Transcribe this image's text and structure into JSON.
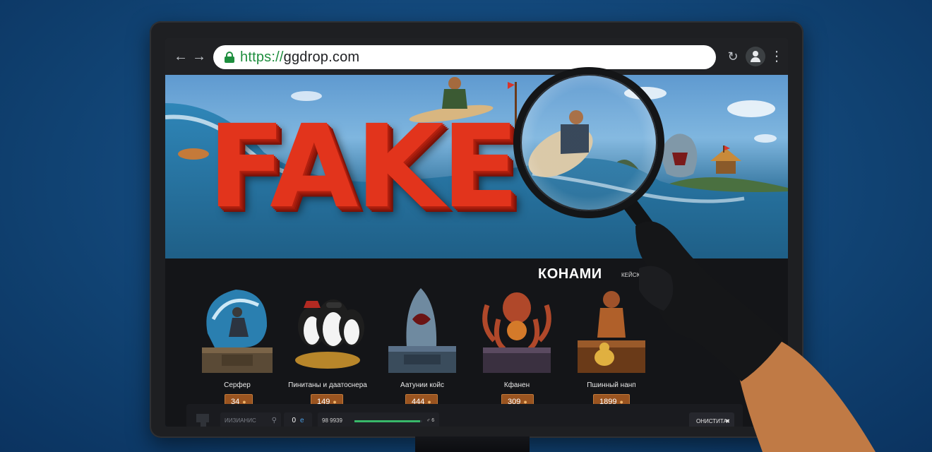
{
  "browser": {
    "url_protocol": "https://",
    "url_host": "ggdrop.com"
  },
  "hero": {
    "stamp": "FAKE"
  },
  "section": {
    "title": "КОНАМИ",
    "subtitle": "КЕЙСЮ"
  },
  "cases": [
    {
      "name": "Серфер",
      "price": "34"
    },
    {
      "name": "Пинитаны и даатоснера",
      "price": "149"
    },
    {
      "name": "Аатунии койс",
      "price": "444"
    },
    {
      "name": "Кфанен",
      "price": "309"
    },
    {
      "name": "Пшинный нанп",
      "price": "1899"
    }
  ],
  "bottom_bar": {
    "search_placeholder": "ИИЗИАНИС",
    "balance": "0",
    "balance_currency": "e",
    "progress_label": "98 9939",
    "progress_fraction": 0.97,
    "progress_suffix": "♂ 6",
    "action_button": "ОНИСТИТА"
  },
  "colors": {
    "stamp": "#e2341c",
    "price_badge": "#9a5420",
    "url_secure": "#1e8e3e",
    "background": "#0f3f6e"
  },
  "icons": {
    "back": "arrow-left-icon",
    "forward": "arrow-right-icon",
    "lock": "lock-icon",
    "reload": "reload-icon",
    "profile": "profile-icon",
    "menu": "more-vert-icon",
    "magnifier": "magnifying-glass-icon"
  }
}
